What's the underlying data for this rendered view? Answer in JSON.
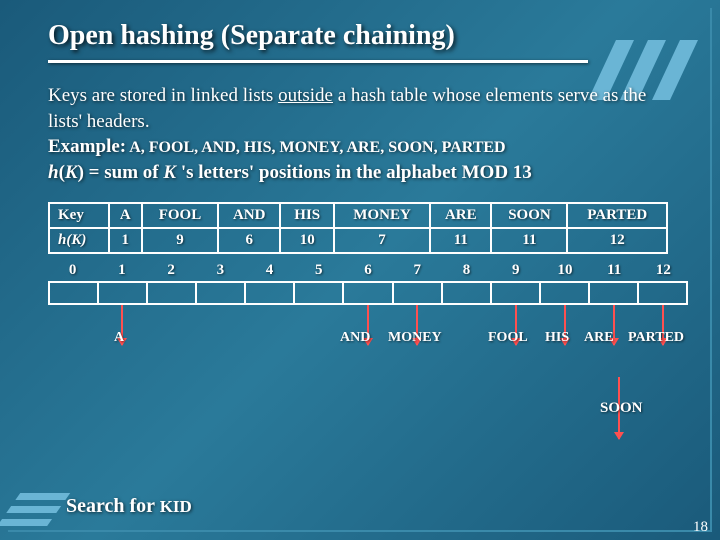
{
  "title": "Open hashing (Separate chaining)",
  "body": {
    "line1a": "Keys are stored in linked lists ",
    "line1b": "outside",
    "line1c": " a hash table whose elements serve as the lists' headers.",
    "exampleLabel": "Example:",
    "exampleWords": " A, FOOL, AND, HIS, MONEY, ARE, SOON, PARTED",
    "hashFnA": "h",
    "hashFnB": "(",
    "hashFnC": "K",
    "hashFnD": ") = sum of ",
    "hashFnE": "K",
    "hashFnF": " 's letters' positions in the alphabet MOD 13"
  },
  "table": {
    "header": [
      "Key",
      "A",
      "FOOL",
      "AND",
      "HIS",
      "MONEY",
      "ARE",
      "SOON",
      "PARTED"
    ],
    "row2Label": "h(K)",
    "row2": [
      "1",
      "9",
      "6",
      "10",
      "7",
      "11",
      "11",
      "12"
    ]
  },
  "buckets": {
    "indices": [
      "0",
      "1",
      "2",
      "3",
      "4",
      "5",
      "6",
      "7",
      "8",
      "9",
      "10",
      "11",
      "12"
    ],
    "chain1": "A",
    "chain6": "AND",
    "chain7": "MONEY",
    "chain9": "FOOL",
    "chain10": "HIS",
    "chain11a": "ARE",
    "chain11b": "SOON",
    "chain12": "PARTED"
  },
  "searchFor": "Search for ",
  "searchKey": "KID",
  "pageNum": "18"
}
